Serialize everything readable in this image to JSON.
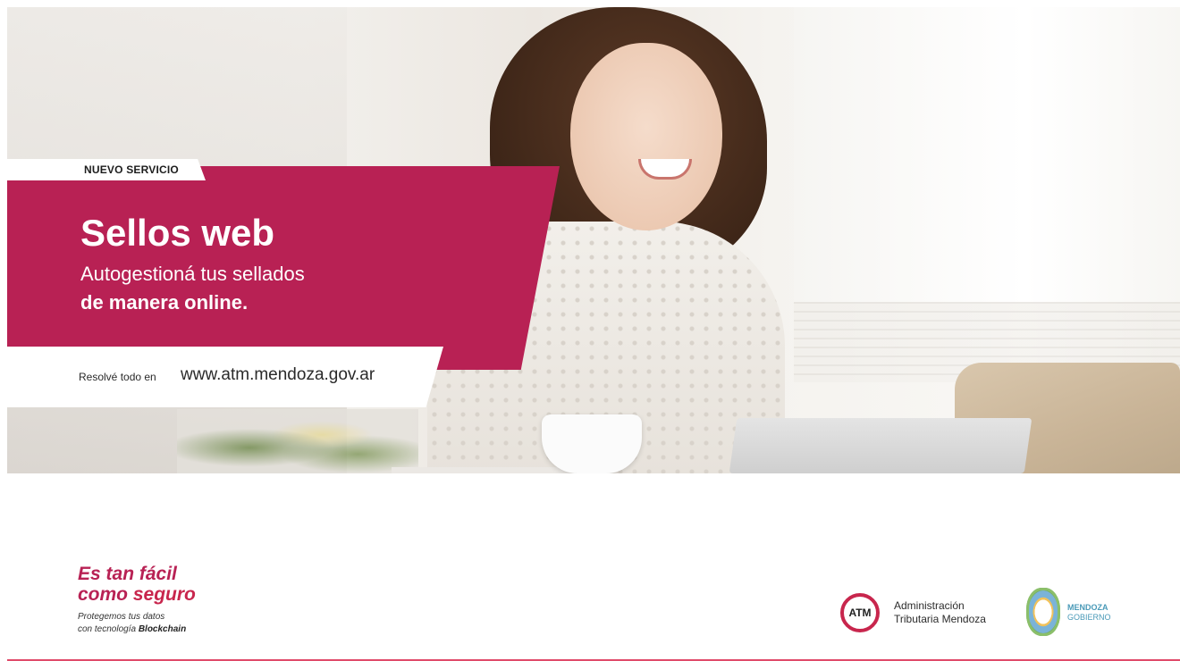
{
  "banner": {
    "tag": "NUEVO SERVICIO",
    "title": "Sellos web",
    "subtitle_line1": "Autogestioná tus sellados",
    "subtitle_line2": "de manera online.",
    "url_lead": "Resolvé todo en",
    "url": "www.atm.mendoza.gov.ar"
  },
  "footer": {
    "slogan_line1": "Es tan fácil",
    "slogan_line2_a": "como ",
    "slogan_line2_b": "seguro",
    "fine_line1": "Protegemos tus datos",
    "fine_line2_a": "con tecnología ",
    "fine_line2_b": "Blockchain",
    "atm_badge": "ATM",
    "atm_name_line1": "Administración",
    "atm_name_line2": "Tributaria Mendoza",
    "gov_line1": "MENDOZA",
    "gov_line2": "GOBIERNO"
  },
  "colors": {
    "brand": "#b82154",
    "accent_line": "#e04a6a",
    "gov_blue": "#4a9ab8"
  }
}
